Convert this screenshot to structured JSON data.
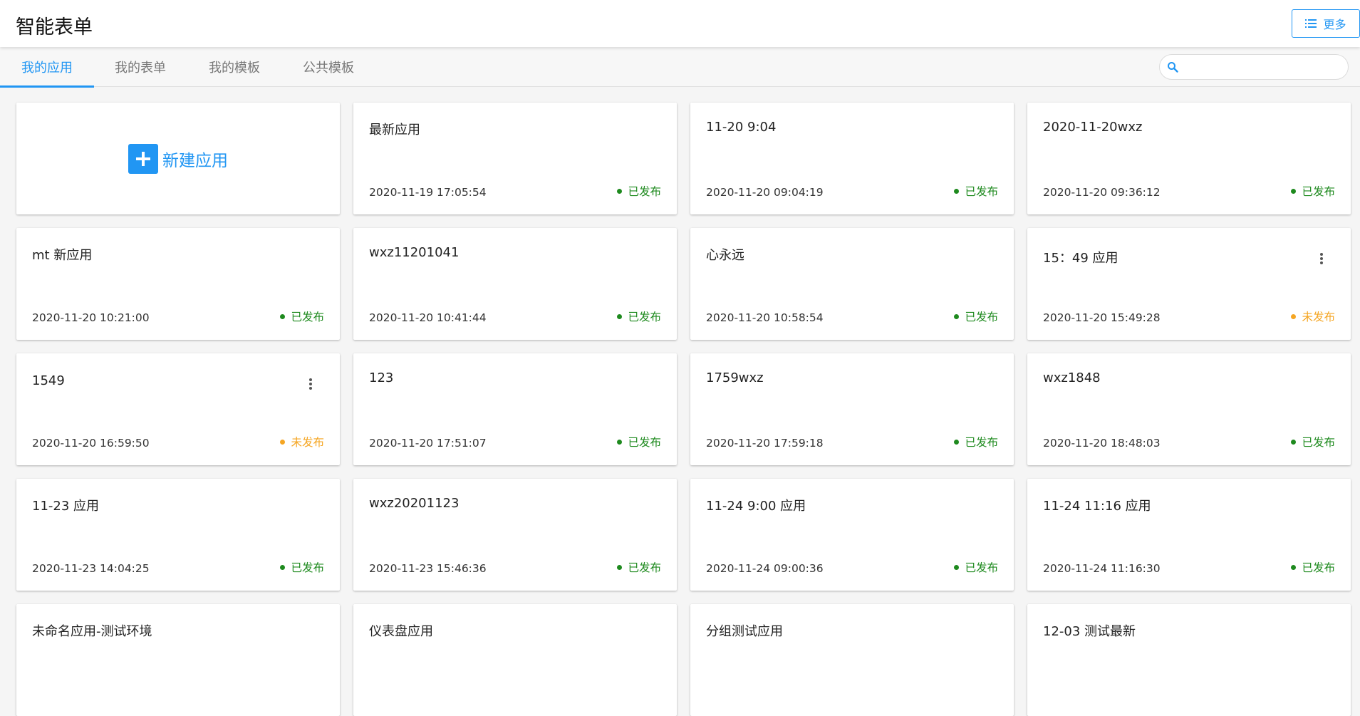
{
  "header": {
    "title": "智能表单",
    "more_label": "更多"
  },
  "tabs": [
    {
      "label": "我的应用",
      "active": true
    },
    {
      "label": "我的表单",
      "active": false
    },
    {
      "label": "我的模板",
      "active": false
    },
    {
      "label": "公共模板",
      "active": false
    }
  ],
  "search": {
    "placeholder": "",
    "value": ""
  },
  "new_app": {
    "label": "新建应用"
  },
  "colors": {
    "accent": "#2196f3",
    "published": "#1e8a1e",
    "unpublished": "#f5a623"
  },
  "status_labels": {
    "published": "已发布",
    "unpublished": "未发布"
  },
  "apps": [
    {
      "name": "最新应用",
      "time": "2020-11-19 17:05:54",
      "status": "published",
      "has_menu": false
    },
    {
      "name": "11-20 9:04",
      "time": "2020-11-20 09:04:19",
      "status": "published",
      "has_menu": false
    },
    {
      "name": "2020-11-20wxz",
      "time": "2020-11-20 09:36:12",
      "status": "published",
      "has_menu": false
    },
    {
      "name": "mt 新应用",
      "time": "2020-11-20 10:21:00",
      "status": "published",
      "has_menu": false
    },
    {
      "name": "wxz11201041",
      "time": "2020-11-20 10:41:44",
      "status": "published",
      "has_menu": false
    },
    {
      "name": "心永远",
      "time": "2020-11-20 10:58:54",
      "status": "published",
      "has_menu": false
    },
    {
      "name": "15：49 应用",
      "time": "2020-11-20 15:49:28",
      "status": "unpublished",
      "has_menu": true
    },
    {
      "name": "1549",
      "time": "2020-11-20 16:59:50",
      "status": "unpublished",
      "has_menu": true
    },
    {
      "name": "123",
      "time": "2020-11-20 17:51:07",
      "status": "published",
      "has_menu": false
    },
    {
      "name": "1759wxz",
      "time": "2020-11-20 17:59:18",
      "status": "published",
      "has_menu": false
    },
    {
      "name": "wxz1848",
      "time": "2020-11-20 18:48:03",
      "status": "published",
      "has_menu": false
    },
    {
      "name": "11-23 应用",
      "time": "2020-11-23 14:04:25",
      "status": "published",
      "has_menu": false
    },
    {
      "name": "wxz20201123",
      "time": "2020-11-23 15:46:36",
      "status": "published",
      "has_menu": false
    },
    {
      "name": "11-24 9:00 应用",
      "time": "2020-11-24 09:00:36",
      "status": "published",
      "has_menu": false
    },
    {
      "name": "11-24 11:16 应用",
      "time": "2020-11-24 11:16:30",
      "status": "published",
      "has_menu": false
    },
    {
      "name": "未命名应用-测试环境",
      "time": "",
      "status": "",
      "has_menu": false
    },
    {
      "name": "仪表盘应用",
      "time": "",
      "status": "",
      "has_menu": false
    },
    {
      "name": "分组测试应用",
      "time": "",
      "status": "",
      "has_menu": false
    },
    {
      "name": "12-03 测试最新",
      "time": "",
      "status": "",
      "has_menu": false
    }
  ]
}
